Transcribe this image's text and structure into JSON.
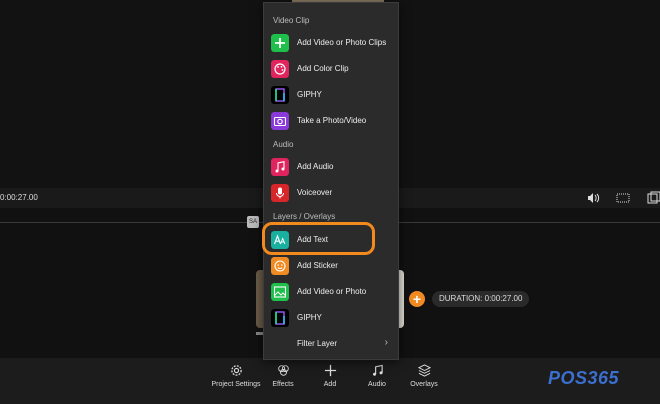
{
  "menu": {
    "sections": [
      {
        "title": "Video Clip",
        "items": [
          {
            "label": "Add Video or Photo Clips",
            "icon": "plus-icon",
            "color": "#1fbf4c"
          },
          {
            "label": "Add Color Clip",
            "icon": "palette-icon",
            "color": "#e0245e"
          },
          {
            "label": "GIPHY",
            "icon": "giphy-icon",
            "color": "#000000"
          },
          {
            "label": "Take a Photo/Video",
            "icon": "camera-icon",
            "color": "#8a3ad8"
          }
        ]
      },
      {
        "title": "Audio",
        "items": [
          {
            "label": "Add Audio",
            "icon": "music-note-icon",
            "color": "#e0245e"
          },
          {
            "label": "Voiceover",
            "icon": "microphone-icon",
            "color": "#d6262a"
          }
        ]
      },
      {
        "title": "Layers / Overlays",
        "items": [
          {
            "label": "Add Text",
            "icon": "text-icon",
            "color": "#1ab0a0"
          },
          {
            "label": "Add Sticker",
            "icon": "smiley-icon",
            "color": "#f08a22"
          },
          {
            "label": "Add Video or Photo",
            "icon": "image-icon",
            "color": "#1fbf4c"
          },
          {
            "label": "GIPHY",
            "icon": "giphy-icon",
            "color": "#000000"
          },
          {
            "label": "Filter Layer",
            "icon": "",
            "color": ""
          }
        ]
      }
    ]
  },
  "timeline": {
    "time": "0:00:27.00",
    "duration": "DURATION: 0:00:27.00",
    "marker": "SA"
  },
  "bottom": {
    "items": [
      {
        "label": "Project Settings",
        "icon": "gear-icon"
      },
      {
        "label": "Effects",
        "icon": "effects-icon"
      },
      {
        "label": "Add",
        "icon": "plus-icon"
      },
      {
        "label": "Audio",
        "icon": "music-icon"
      },
      {
        "label": "Overlays",
        "icon": "layers-icon"
      }
    ]
  },
  "watermark": "POS365",
  "accent": "#f28a1e"
}
